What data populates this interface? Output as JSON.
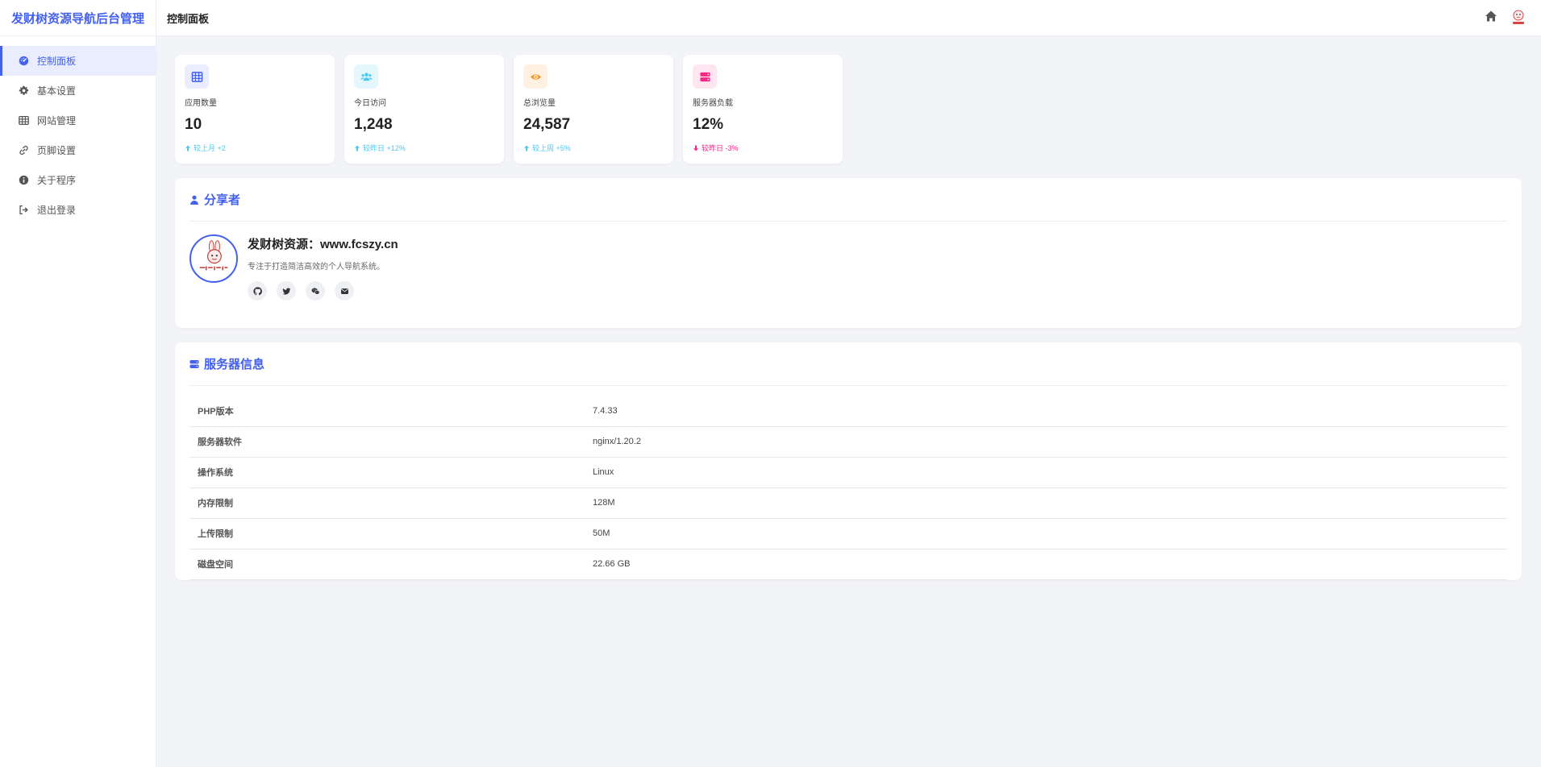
{
  "brand": "发财树资源导航后台管理",
  "header": {
    "title": "控制面板"
  },
  "sidebar": {
    "items": [
      {
        "label": "控制面板",
        "icon": "dashboard-icon",
        "active": true
      },
      {
        "label": "基本设置",
        "icon": "gear-icon"
      },
      {
        "label": "网站管理",
        "icon": "table-icon"
      },
      {
        "label": "页脚设置",
        "icon": "link-icon"
      },
      {
        "label": "关于程序",
        "icon": "info-icon"
      },
      {
        "label": "退出登录",
        "icon": "logout-icon"
      }
    ]
  },
  "stats": [
    {
      "label": "应用数量",
      "value": "10",
      "change": "较上月 +2",
      "trend": "up",
      "icon": "grid-icon",
      "color": "#4361ee",
      "bg": "#e9edfd"
    },
    {
      "label": "今日访问",
      "value": "1,248",
      "change": "较昨日 +12%",
      "trend": "up",
      "icon": "users-icon",
      "color": "#4cc9f0",
      "bg": "#e4f7fd"
    },
    {
      "label": "总浏览量",
      "value": "24,587",
      "change": "较上周 +5%",
      "trend": "up",
      "icon": "eye-icon",
      "color": "#f8961e",
      "bg": "#fef1e1"
    },
    {
      "label": "服务器负载",
      "value": "12%",
      "change": "较昨日 -3%",
      "trend": "down",
      "icon": "server-icon",
      "color": "#f72585",
      "bg": "#fee6f1"
    }
  ],
  "sharer": {
    "heading": "分享者",
    "name": "发财树资源：www.fcszy.cn",
    "description": "专注于打造简洁高效的个人导航系统。",
    "socials": [
      "github-icon",
      "twitter-icon",
      "wechat-icon",
      "mail-icon"
    ]
  },
  "server": {
    "heading": "服务器信息",
    "rows": [
      {
        "key": "PHP版本",
        "value": "7.4.33"
      },
      {
        "key": "服务器软件",
        "value": "nginx/1.20.2"
      },
      {
        "key": "操作系统",
        "value": "Linux"
      },
      {
        "key": "内存限制",
        "value": "128M"
      },
      {
        "key": "上传限制",
        "value": "50M"
      },
      {
        "key": "磁盘空间",
        "value": "22.66 GB"
      }
    ]
  },
  "colors": {
    "accent": "#4361ee",
    "up": "#4cc9f0",
    "down": "#f72585"
  }
}
